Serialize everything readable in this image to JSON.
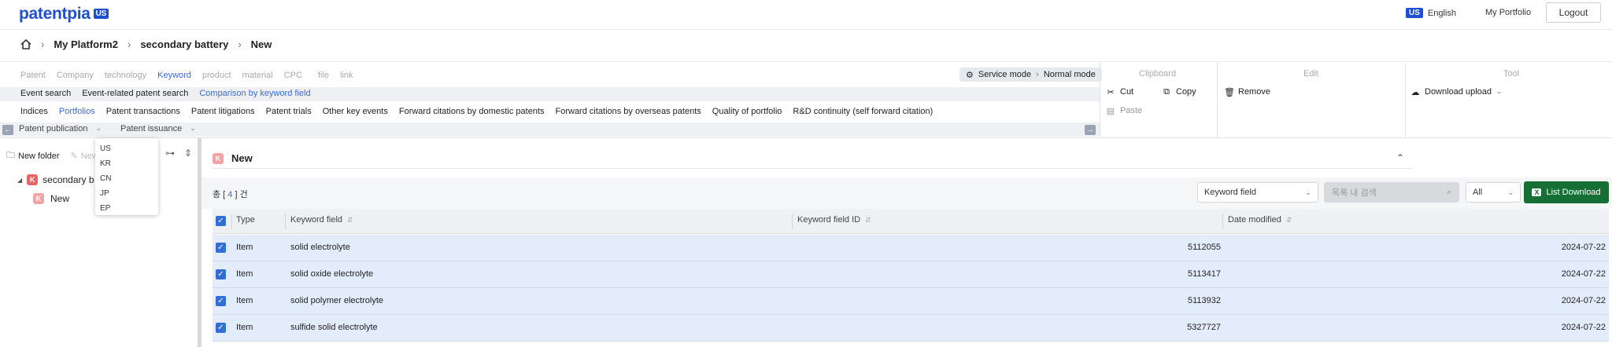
{
  "header": {
    "logo": "patentpia",
    "logo_badge": "US",
    "lang_flag": "US",
    "lang_label": "English",
    "portfolio": "My Portfolio",
    "logout": "Logout"
  },
  "breadcrumb": [
    "My Platform2",
    "secondary battery",
    "New"
  ],
  "ribbon": {
    "tabs1": [
      "Patent",
      "Company",
      "technology",
      "Keyword",
      "product",
      "material",
      "CPC",
      "file",
      "link"
    ],
    "tabs1_active": "Keyword",
    "mode_left": "Service mode",
    "mode_right": "Normal mode",
    "tabs2": [
      "Event search",
      "Event-related patent search",
      "Comparison by keyword field"
    ],
    "tabs3": [
      "Indices",
      "Portfolios",
      "Patent transactions",
      "Patent litigations",
      "Patent trials",
      "Other key events",
      "Forward citations by domestic patents",
      "Forward citations by overseas patents",
      "Quality of portfolio",
      "R&D continuity (self forward citation)"
    ],
    "patent_publication": "Patent publication",
    "patent_issuance": "Patent issuance"
  },
  "panels": {
    "clipboard": "Clipboard",
    "edit": "Edit",
    "tool": "Tool",
    "cut": "Cut",
    "copy": "Copy",
    "paste": "Paste",
    "remove": "Remove",
    "download_upload": "Download upload"
  },
  "tree": {
    "new_folder": "New folder",
    "new_item": "New",
    "root": "secondary b",
    "root_badge": "K",
    "child": "New",
    "child_badge": "K"
  },
  "lang_menu": [
    "US",
    "KR",
    "CN",
    "JP",
    "EP"
  ],
  "main": {
    "title": "New",
    "title_badge": "K",
    "count_prefix": "총 [ ",
    "count": "4",
    "count_suffix": " ] 건",
    "field_select": "Keyword field",
    "search_placeholder": "목록 내 검색",
    "all_select": "All",
    "list_download": "List Download",
    "columns": [
      "Type",
      "Keyword field",
      "Keyword field ID",
      "Date modified"
    ],
    "rows": [
      {
        "type": "Item",
        "field": "solid electrolyte",
        "id": "5112055",
        "date": "2024-07-22"
      },
      {
        "type": "Item",
        "field": "solid oxide electrolyte",
        "id": "5113417",
        "date": "2024-07-22"
      },
      {
        "type": "Item",
        "field": "solid polymer electrolyte",
        "id": "5113932",
        "date": "2024-07-22"
      },
      {
        "type": "Item",
        "field": "sulfide solid electrolyte",
        "id": "5327727",
        "date": "2024-07-22"
      }
    ]
  },
  "colors": {
    "brand": "#1f4fd1",
    "accent": "#3b6be0",
    "excel_green": "#166f35",
    "badge_red": "#e86464",
    "row_selected": "#e3ecfb"
  }
}
